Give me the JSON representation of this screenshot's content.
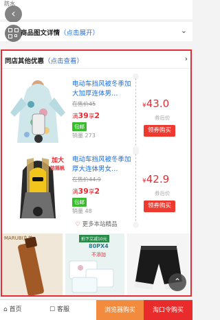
{
  "top": {
    "text": "防水"
  },
  "detail": {
    "title": "商品图文详情",
    "link": "（点击展开）"
  },
  "promo": {
    "title": "同店其他优惠",
    "link": "（点击查看）",
    "items": [
      {
        "name": "电动车挡风被冬季加大加厚连体男…",
        "was_price": "在售价45",
        "deal_prefix": "满",
        "deal_amount": "39",
        "deal_sep": "享",
        "deal_off": "2",
        "badge": "包邮",
        "sales": "销量 273",
        "currency": "¥",
        "price": "43.0",
        "coupon_label": "券后价",
        "buy_label": "领券购买"
      },
      {
        "name": "电动车挡风被冬季加厚大连体男女…",
        "was_price": "在售价44.9",
        "deal_prefix": "满",
        "deal_amount": "39",
        "deal_sep": "享",
        "deal_off": "2",
        "badge": "包邮",
        "sales": "销量 48",
        "currency": "¥",
        "price": "42.9",
        "coupon_label": "券后价",
        "buy_label": "领券购买",
        "image_caption_1": "加大",
        "image_caption_2": "防摇帆"
      }
    ],
    "more_label": "更多本站精品"
  },
  "ads": [
    {
      "brand": "MARUBI丸美"
    },
    {
      "line1": "拍下立减10元",
      "line2": "80PX4",
      "line3": "不添加"
    },
    {
      "label": ""
    }
  ],
  "bottom": {
    "home": "首页",
    "service": "客服",
    "browser_buy": "浏览器购买",
    "code_buy": "淘口令购买"
  },
  "colors": {
    "accent_red": "#e52c34",
    "link_blue": "#2f6fd6",
    "orange": "#f28b3d"
  },
  "icons": [
    "back-arrow-icon",
    "qr-code-icon",
    "chevron-down-icon",
    "chevron-right-icon",
    "heart-icon",
    "home-icon",
    "chat-icon",
    "up-arrow-icon"
  ]
}
